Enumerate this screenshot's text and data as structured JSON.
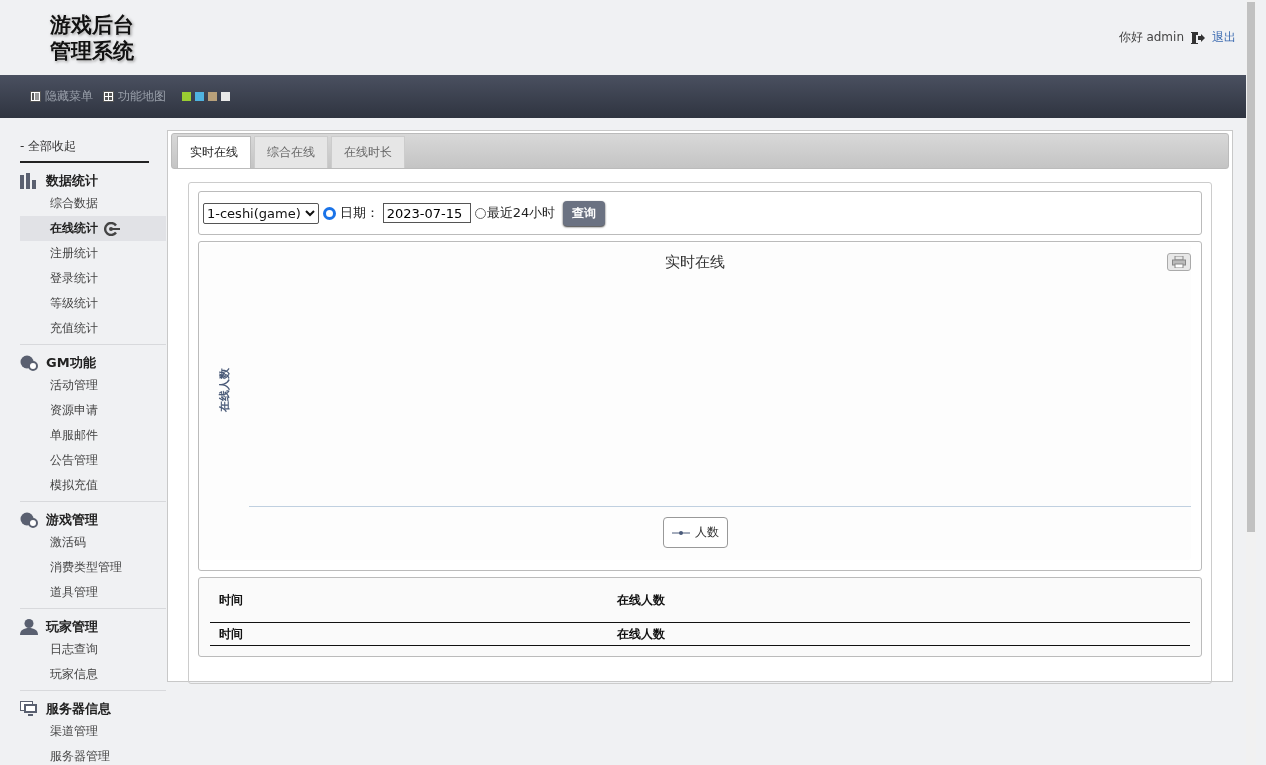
{
  "header": {
    "logo_lines": [
      "游戏后台",
      "管理系统"
    ],
    "greeting": "你好 admin",
    "logout": "退出"
  },
  "toolbar": {
    "items": [
      {
        "kind": "hide",
        "label": "隐藏菜单"
      },
      {
        "kind": "map",
        "label": "功能地图"
      }
    ],
    "swatches": [
      {
        "color": "#9acd32"
      },
      {
        "color": "#4fb3e0"
      },
      {
        "color": "#b8a07a"
      },
      {
        "color": "#e8e8e8"
      }
    ]
  },
  "sidebar": {
    "collapse": "- 全部收起",
    "groups": [
      {
        "kind": "chart",
        "title": "数据统计",
        "items": [
          {
            "label": "综合数据",
            "selected": false
          },
          {
            "label": "在线统计",
            "selected": true
          },
          {
            "label": "注册统计",
            "selected": false
          },
          {
            "label": "登录统计",
            "selected": false
          },
          {
            "label": "等级统计",
            "selected": false
          },
          {
            "label": "充值统计",
            "selected": false
          }
        ]
      },
      {
        "kind": "circles",
        "title": "GM功能",
        "items": [
          {
            "label": "活动管理",
            "selected": false
          },
          {
            "label": "资源申请",
            "selected": false
          },
          {
            "label": "单服邮件",
            "selected": false
          },
          {
            "label": "公告管理",
            "selected": false
          },
          {
            "label": "模拟充值",
            "selected": false
          }
        ]
      },
      {
        "kind": "circles",
        "title": "游戏管理",
        "items": [
          {
            "label": "激活码",
            "selected": false
          },
          {
            "label": "消费类型管理",
            "selected": false
          },
          {
            "label": "道具管理",
            "selected": false
          }
        ]
      },
      {
        "kind": "person",
        "title": "玩家管理",
        "items": [
          {
            "label": "日志查询",
            "selected": false
          },
          {
            "label": "玩家信息",
            "selected": false
          }
        ]
      },
      {
        "kind": "monitor",
        "title": "服务器信息",
        "items": [
          {
            "label": "渠道管理",
            "selected": false
          },
          {
            "label": "服务器管理",
            "selected": false
          }
        ]
      }
    ]
  },
  "tabs": [
    {
      "label": "实时在线",
      "selected": true
    },
    {
      "label": "综合在线",
      "selected": false
    },
    {
      "label": "在线时长",
      "selected": false
    }
  ],
  "query": {
    "server": "1-ceshi(game)",
    "date_label": "日期：",
    "date_selected": true,
    "date": "2023-07-15",
    "last24_label": "最近24小时",
    "last24_selected": false,
    "button": "查询"
  },
  "chart": {
    "title": "实时在线",
    "ylabel": "在线人数",
    "legend": "人数"
  },
  "table": {
    "columns": [
      "时间",
      "在线人数"
    ],
    "footer": [
      "时间",
      "在线人数"
    ]
  }
}
